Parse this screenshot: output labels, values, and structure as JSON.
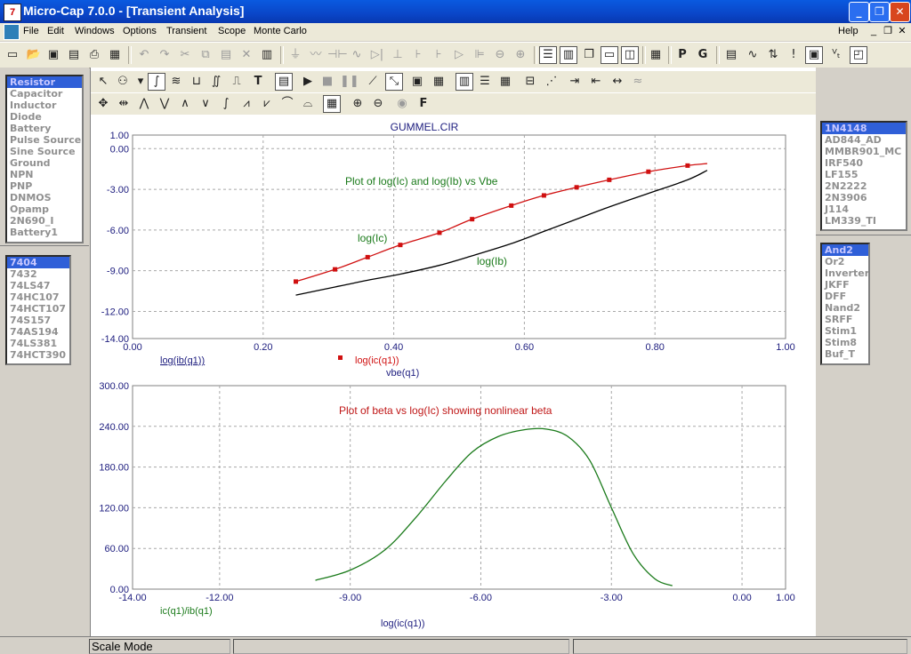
{
  "window": {
    "title": "Micro-Cap 7.0.0 - [Transient Analysis]",
    "app_icon": "7"
  },
  "menu": {
    "items": [
      "File",
      "Edit",
      "Windows",
      "Options",
      "Transient",
      "Scope",
      "Monte Carlo"
    ],
    "help": "Help"
  },
  "components": {
    "items": [
      "Resistor",
      "Capacitor",
      "Inductor",
      "Diode",
      "Battery",
      "Pulse Source",
      "Sine Source",
      "Ground",
      "NPN",
      "PNP",
      "DNMOS",
      "Opamp",
      "2N690_I",
      "Battery1"
    ],
    "selected": 0
  },
  "digital": {
    "items": [
      "7404",
      "7432",
      "74LS47",
      "74HC107",
      "74HCT107",
      "74S157",
      "74AS194",
      "74LS381",
      "74HCT390"
    ],
    "selected": 0
  },
  "parts": {
    "items": [
      "1N4148",
      "AD844_AD",
      "MMBR901_MC",
      "IRF540",
      "LF155",
      "2N2222",
      "2N3906",
      "J114",
      "LM339_TI"
    ],
    "selected": 0
  },
  "gates": {
    "items": [
      "And2",
      "Or2",
      "Inverter",
      "JKFF",
      "DFF",
      "Nand2",
      "SRFF",
      "Stim1",
      "Stim8",
      "Buf_T"
    ],
    "selected": 0
  },
  "status": {
    "mode": "Scale Mode"
  },
  "chart_data": [
    {
      "type": "line",
      "title": "GUMMEL.CIR",
      "annotation": "Plot of log(Ic) and log(Ib) vs Vbe",
      "xlabel": "vbe(q1)",
      "xlim": [
        0,
        1
      ],
      "ylim": [
        -14,
        1
      ],
      "xticks": [
        "0.00",
        "0.20",
        "0.40",
        "0.60",
        "0.80",
        "1.00"
      ],
      "yticks": [
        "1.00",
        "0.00",
        "-3.00",
        "-6.00",
        "-9.00",
        "-12.00",
        "-14.00"
      ],
      "grid": true,
      "legend": [
        "log(ib(q1))",
        "log(ic(q1))"
      ],
      "series": [
        {
          "name": "log(ic(q1))",
          "label": "log(Ic)",
          "color": "#d01010",
          "markers": true,
          "x": [
            0.25,
            0.31,
            0.36,
            0.41,
            0.47,
            0.52,
            0.58,
            0.63,
            0.68,
            0.73,
            0.79,
            0.85,
            0.88
          ],
          "y": [
            -9.8,
            -8.9,
            -8.0,
            -7.1,
            -6.2,
            -5.2,
            -4.2,
            -3.45,
            -2.85,
            -2.3,
            -1.7,
            -1.25,
            -1.1
          ]
        },
        {
          "name": "log(ib(q1))",
          "label": "log(Ib)",
          "color": "#000000",
          "markers": false,
          "x": [
            0.25,
            0.31,
            0.36,
            0.41,
            0.47,
            0.52,
            0.58,
            0.63,
            0.68,
            0.73,
            0.79,
            0.85,
            0.88
          ],
          "y": [
            -10.8,
            -10.2,
            -9.7,
            -9.25,
            -8.6,
            -7.9,
            -7.0,
            -6.1,
            -5.2,
            -4.3,
            -3.3,
            -2.3,
            -1.6
          ]
        }
      ]
    },
    {
      "type": "line",
      "annotation": "Plot of beta vs log(Ic) showing nonlinear beta",
      "xlabel": "log(ic(q1))",
      "xlim": [
        -14,
        1
      ],
      "ylim": [
        0,
        300
      ],
      "xticks": [
        "-14.00",
        "-12.00",
        "-9.00",
        "-6.00",
        "-3.00",
        "0.00",
        "1.00"
      ],
      "yticks": [
        "300.00",
        "240.00",
        "180.00",
        "120.00",
        "60.00",
        "0.00"
      ],
      "grid": true,
      "legend": [
        "ic(q1)/ib(q1)"
      ],
      "series": [
        {
          "name": "ic(q1)/ib(q1)",
          "color": "#1a7a1a",
          "x": [
            -9.8,
            -9.0,
            -8.2,
            -7.5,
            -6.8,
            -6.2,
            -5.6,
            -5.0,
            -4.5,
            -4.0,
            -3.5,
            -3.0,
            -2.5,
            -2.0,
            -1.6
          ],
          "y": [
            13,
            28,
            58,
            105,
            160,
            202,
            225,
            235,
            236,
            225,
            190,
            120,
            52,
            15,
            5
          ]
        }
      ]
    }
  ]
}
